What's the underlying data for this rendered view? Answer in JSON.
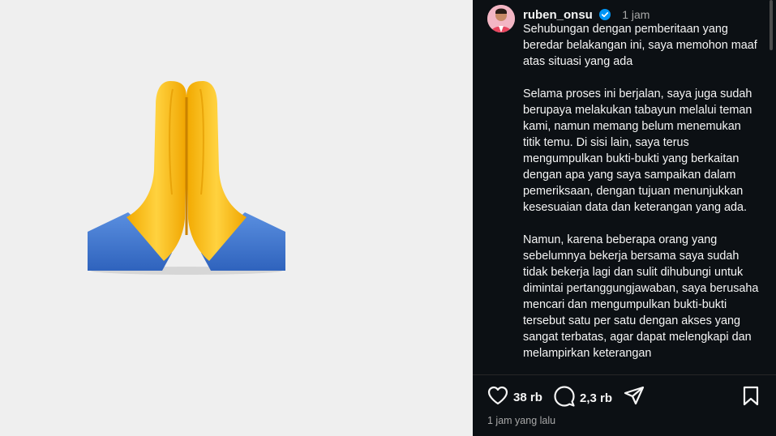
{
  "media": {
    "emoji": "folded-hands",
    "background": "#efefef"
  },
  "post": {
    "username": "ruben_onsu",
    "verified": true,
    "time": "1 jam",
    "caption_paragraphs": [
      "Sehubungan dengan pemberitaan yang beredar belakangan ini, saya memohon maaf atas situasi yang ada",
      "Selama proses ini berjalan, saya juga sudah berupaya melakukan tabayun melalui teman kami, namun memang belum menemukan titik temu. Di sisi lain, saya terus mengumpulkan bukti-bukti yang berkaitan dengan apa yang saya sampaikan dalam pemeriksaan, dengan tujuan menunjukkan kesesuaian data dan keterangan yang ada.",
      "Namun, karena beberapa orang yang sebelumnya bekerja bersama saya sudah tidak bekerja lagi dan sulit dihubungi untuk dimintai pertanggungjawaban, saya berusaha mencari dan mengumpulkan bukti-bukti tersebut satu per satu dengan akses yang sangat terbatas, agar dapat melengkapi dan melampirkan keterangan"
    ],
    "likes": "38 rb",
    "comments": "2,3 rb",
    "posted_ago": "1 jam yang lalu"
  },
  "colors": {
    "panel_bg": "#0c1014",
    "text": "#f5f5f5",
    "muted": "#a8a8a8",
    "verified_blue": "#0095f6"
  },
  "icons": [
    "heart-icon",
    "comment-icon",
    "share-icon",
    "bookmark-icon",
    "verified-badge-icon"
  ]
}
